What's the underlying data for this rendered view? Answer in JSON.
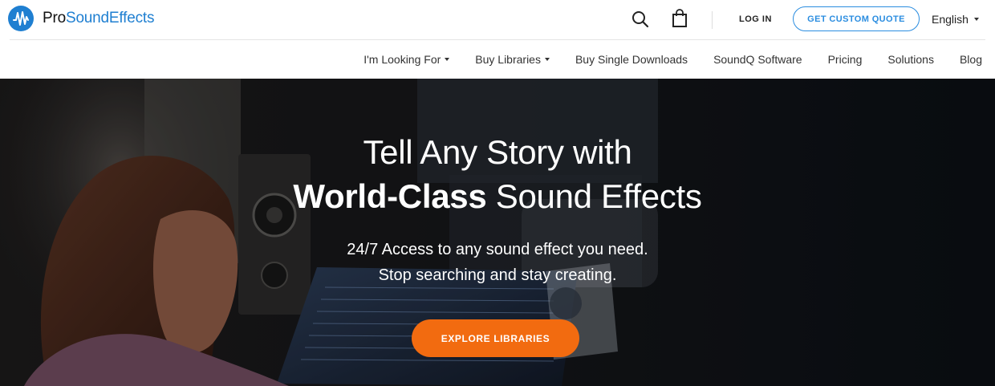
{
  "brand": {
    "name_part1": "Pro",
    "name_part2": "SoundEffects",
    "color": "#1f7fd1"
  },
  "header": {
    "login_label": "LOG IN",
    "quote_label": "GET CUSTOM QUOTE",
    "language": "English",
    "icons": [
      "search-icon",
      "shopping-bag-icon",
      "chevron-down-icon"
    ]
  },
  "nav": {
    "items": [
      {
        "label": "I'm Looking For",
        "dropdown": true
      },
      {
        "label": "Buy Libraries",
        "dropdown": true
      },
      {
        "label": "Buy Single Downloads",
        "dropdown": false
      },
      {
        "label": "SoundQ Software",
        "dropdown": false
      },
      {
        "label": "Pricing",
        "dropdown": false
      },
      {
        "label": "Solutions",
        "dropdown": false
      },
      {
        "label": "Blog",
        "dropdown": false
      }
    ]
  },
  "hero": {
    "title_line1": "Tell Any Story with",
    "title_bold": "World-Class",
    "title_rest": " Sound Effects",
    "subtitle_line1": "24/7 Access to any sound effect you need.",
    "subtitle_line2": "Stop searching and stay creating.",
    "cta_label": "EXPLORE LIBRARIES",
    "cta_color": "#f26b10"
  }
}
